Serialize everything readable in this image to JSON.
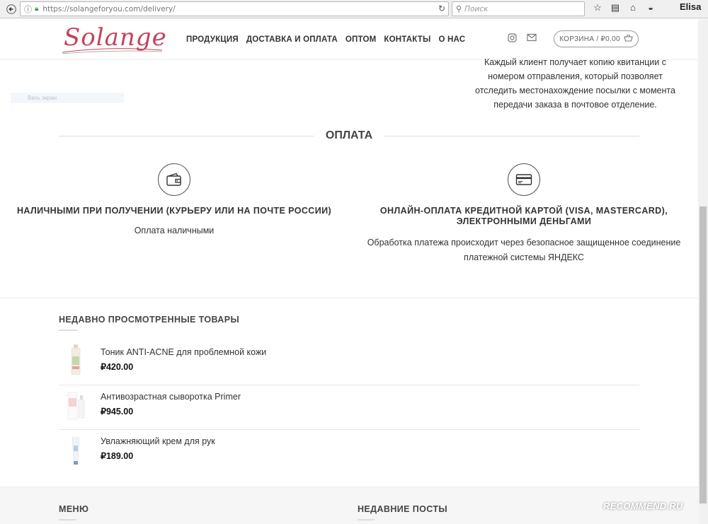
{
  "browser": {
    "url": "https://solangeforyou.com/delivery/",
    "search_placeholder": "Поиск",
    "user": "Elisa"
  },
  "header": {
    "logo_text": "Solange",
    "nav": [
      "ПРОДУКЦИЯ",
      "ДОСТАВКА И ОПЛАТА",
      "ОПТОМ",
      "КОНТАКТЫ",
      "О НАС"
    ],
    "cart_label": "КОРЗИНА / ₽0.00"
  },
  "delivery": {
    "text": "Каждый клиент получает копию квитанции с номером отправления, который позволяет отследить местонахождение посылки с момента передачи заказа в почтовое отделение."
  },
  "ghost_field": "Весь экран",
  "payment": {
    "title": "ОПЛАТА",
    "cash_title": "НАЛИЧНЫМИ ПРИ ПОЛУЧЕНИИ (КУРЬЕРУ ИЛИ НА ПОЧТЕ РОССИИ)",
    "cash_desc": "Оплата наличными",
    "card_title": "ОНЛАЙН-ОПЛАТА КРЕДИТНОЙ КАРТОЙ (VISA, MASTERCARD), ЭЛЕКТРОННЫМИ ДЕНЬГАМИ",
    "card_desc": "Обработка платежа происходит через безопасное защищенное соединение платежной системы ЯНДЕКС"
  },
  "recent": {
    "title": "НЕДАВНО ПРОСМОТРЕННЫЕ ТОВАРЫ",
    "items": [
      {
        "name": "Тоник ANTI-ACNE для проблемной кожи",
        "price": "₽420.00"
      },
      {
        "name": "Антивозрастная сыворотка Primer",
        "price": "₽945.00"
      },
      {
        "name": "Увлажняющий крем для рук",
        "price": "₽189.00"
      }
    ]
  },
  "footer": {
    "menu_title": "МЕНЮ",
    "posts_title": "НЕДАВНИЕ ПОСТЫ"
  },
  "watermark": "RECOMMEND.RU",
  "colors": {
    "brand": "#c7415b",
    "text": "#333333"
  }
}
